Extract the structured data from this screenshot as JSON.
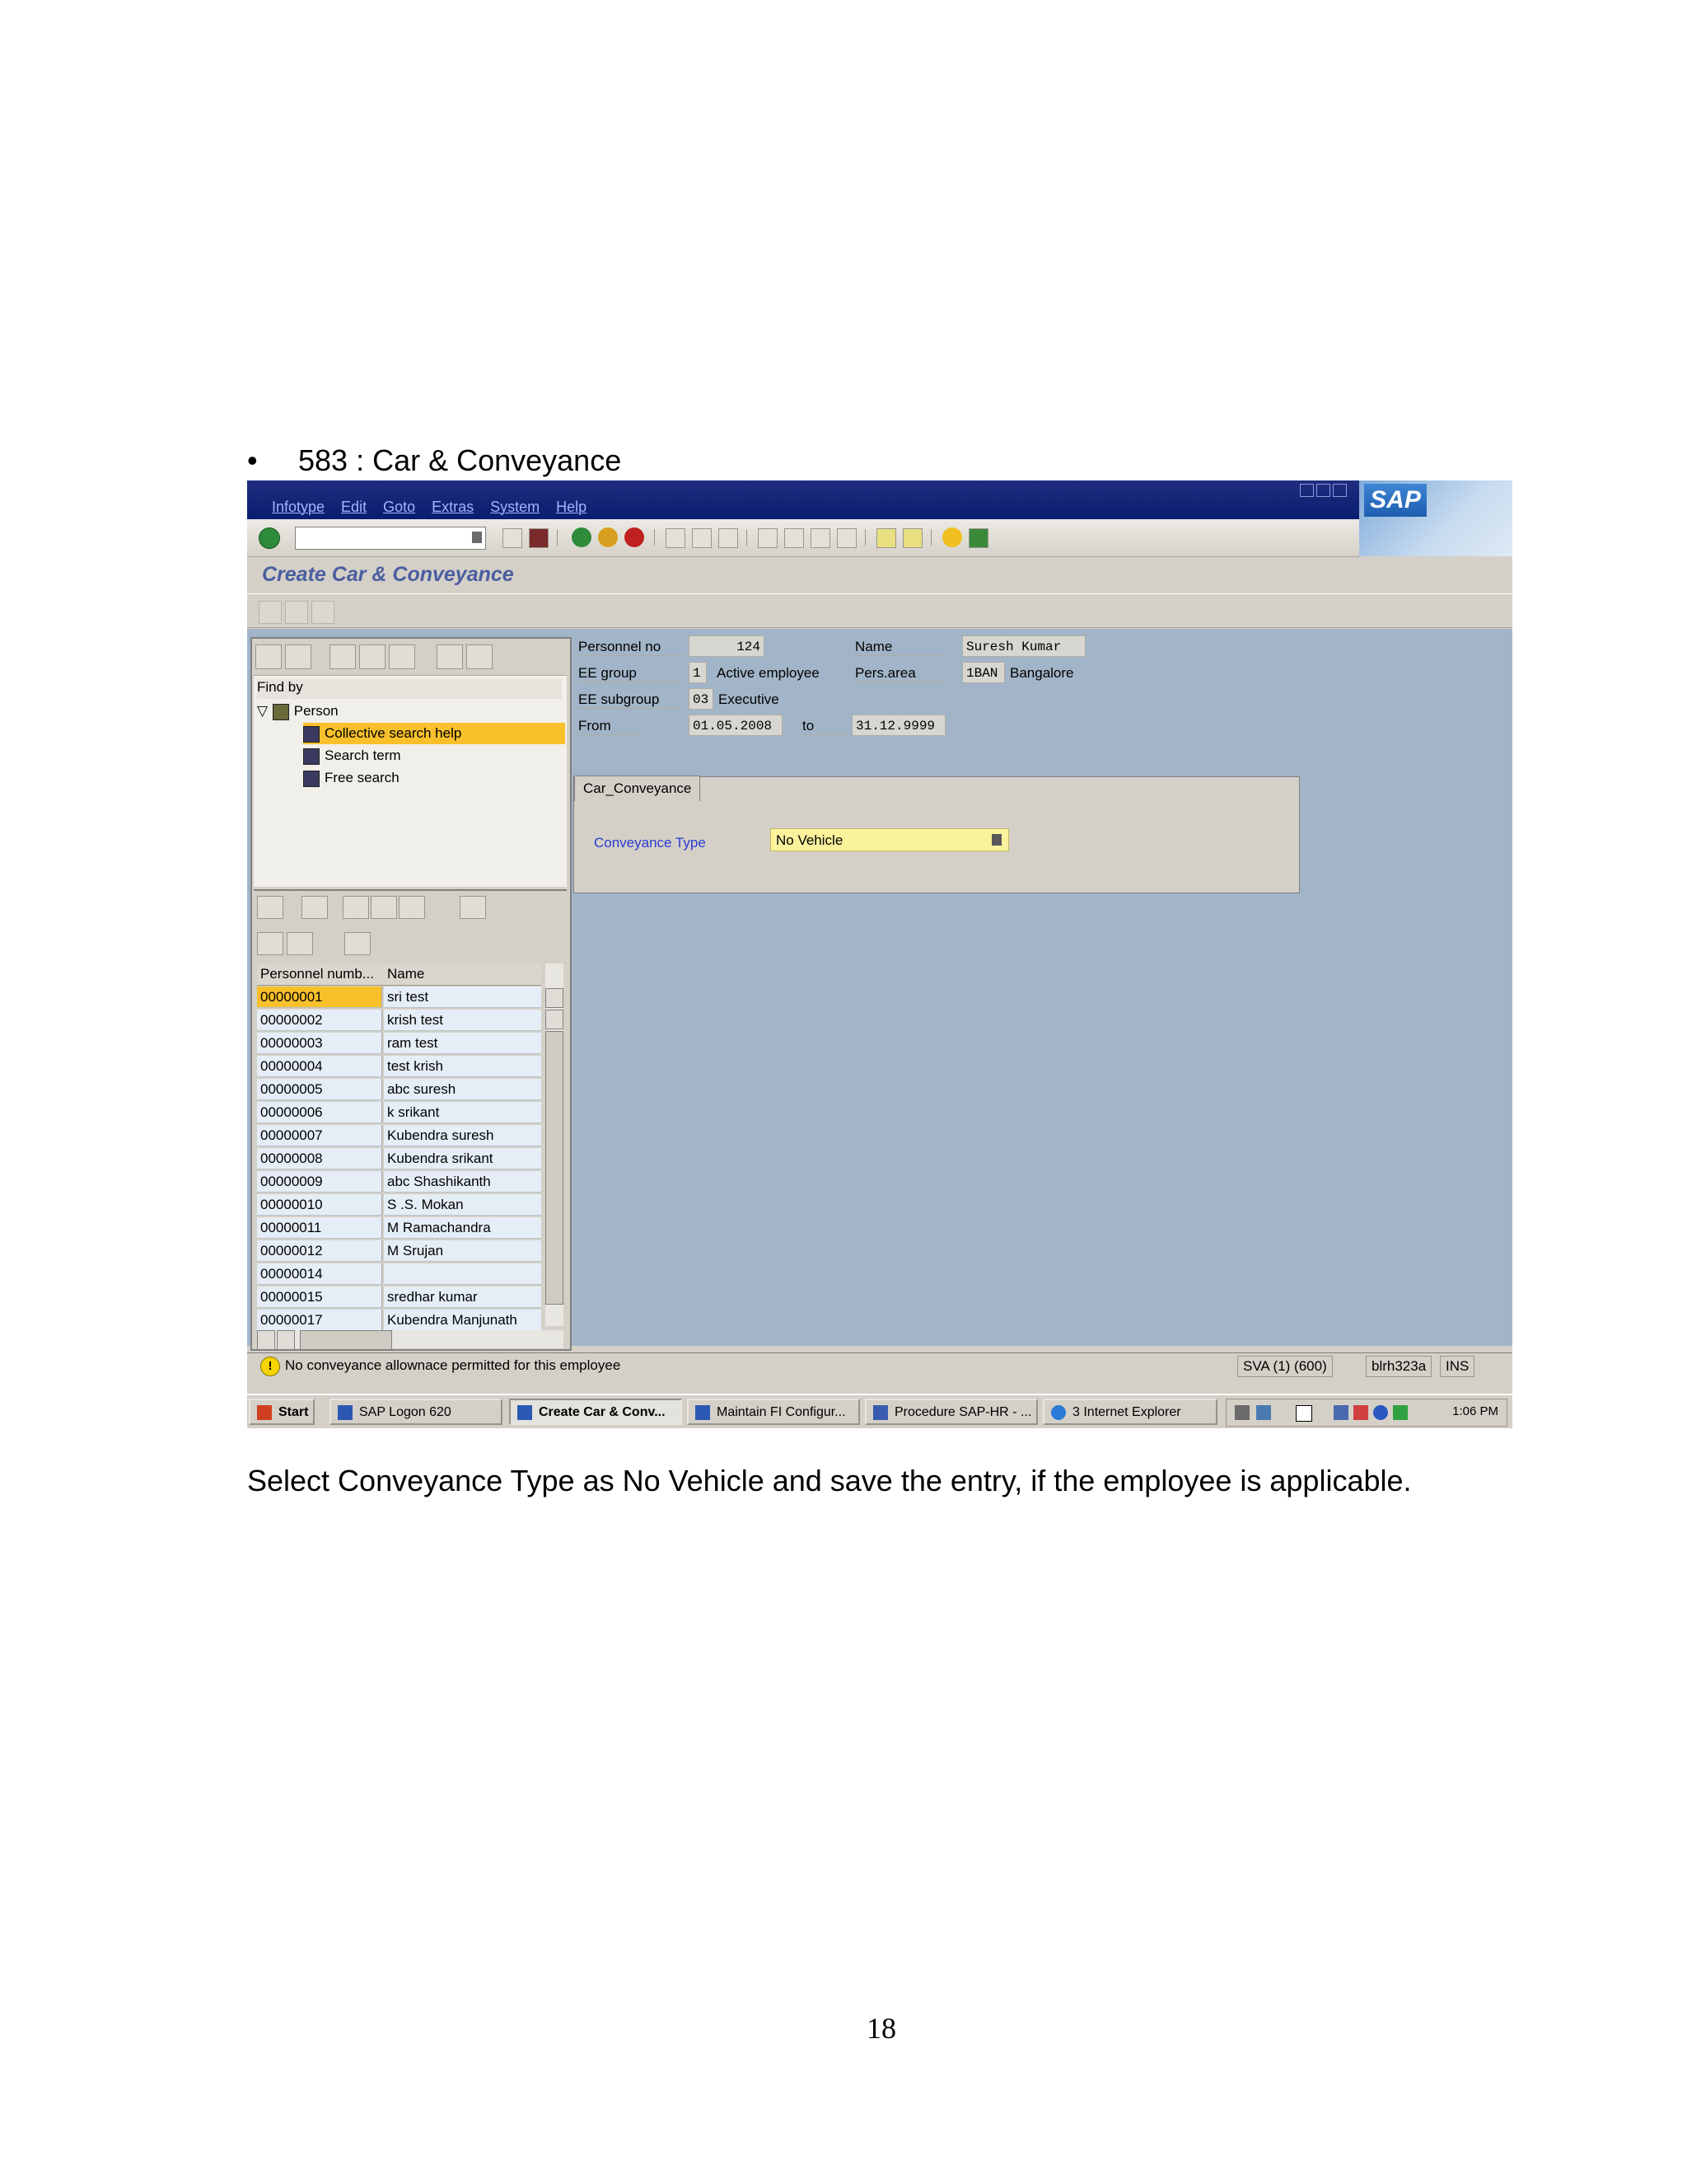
{
  "document": {
    "heading_bullet": "•",
    "heading": "583 : Car & Conveyance",
    "caption": "Select Conveyance Type as No Vehicle and save the entry, if the employee is applicable.",
    "page_number": "18"
  },
  "window": {
    "menu": [
      "Infotype",
      "Edit",
      "Goto",
      "Extras",
      "System",
      "Help"
    ],
    "logo_text": "SAP",
    "screen_title": "Create Car & Conveyance"
  },
  "object_manager": {
    "find_by_label": "Find by",
    "tree": {
      "root": "Person",
      "children": [
        "Collective search help",
        "Search term",
        "Free search"
      ],
      "selected": "Collective search help"
    },
    "hit_list": {
      "columns": [
        "Personnel numb...",
        "Name"
      ],
      "rows": [
        {
          "no": "00000001",
          "name": "sri test"
        },
        {
          "no": "00000002",
          "name": "krish test"
        },
        {
          "no": "00000003",
          "name": "ram test"
        },
        {
          "no": "00000004",
          "name": "test krish"
        },
        {
          "no": "00000005",
          "name": "abc suresh"
        },
        {
          "no": "00000006",
          "name": "k srikant"
        },
        {
          "no": "00000007",
          "name": "Kubendra suresh"
        },
        {
          "no": "00000008",
          "name": "Kubendra srikant"
        },
        {
          "no": "00000009",
          "name": "abc Shashikanth"
        },
        {
          "no": "00000010",
          "name": "S .S. Mokan"
        },
        {
          "no": "00000011",
          "name": "M Ramachandra"
        },
        {
          "no": "00000012",
          "name": "M Srujan"
        },
        {
          "no": "00000014",
          "name": ""
        },
        {
          "no": "00000015",
          "name": "sredhar kumar"
        },
        {
          "no": "00000017",
          "name": "Kubendra Manjunath"
        }
      ],
      "selected_row": "00000001"
    }
  },
  "header": {
    "personnel_no_label": "Personnel no",
    "personnel_no": "124",
    "name_label": "Name",
    "name": "Suresh Kumar",
    "ee_group_label": "EE group",
    "ee_group_code": "1",
    "ee_group_text": "Active employee",
    "pers_area_label": "Pers.area",
    "pers_area_code": "1BAN",
    "pers_area_text": "Bangalore",
    "ee_subgroup_label": "EE subgroup",
    "ee_subgroup_code": "03",
    "ee_subgroup_text": "Executive",
    "from_label": "From",
    "from_date": "01.05.2008",
    "to_label": "to",
    "to_date": "31.12.9999"
  },
  "conveyance": {
    "tab_label": "Car_Conveyance",
    "type_label": "Conveyance Type",
    "type_value": "No Vehicle"
  },
  "statusbar": {
    "message": "No conveyance allownace permitted for this employee",
    "system": "SVA (1) (600)",
    "server": "blrh323a",
    "mode": "INS"
  },
  "taskbar": {
    "start": "Start",
    "tasks": [
      "SAP Logon 620",
      "Create Car & Conv...",
      "Maintain FI Configur...",
      "Procedure SAP-HR - ...",
      "3 Internet Explorer"
    ],
    "active_task": "Create Car & Conv...",
    "clock": "1:06 PM"
  },
  "colors": {
    "title_bar": "#0a1d6e",
    "work_area": "#a2b5c8",
    "selection": "#f8c02a",
    "required_field": "#fbf29c",
    "screen_title": "#4a5ea0"
  }
}
